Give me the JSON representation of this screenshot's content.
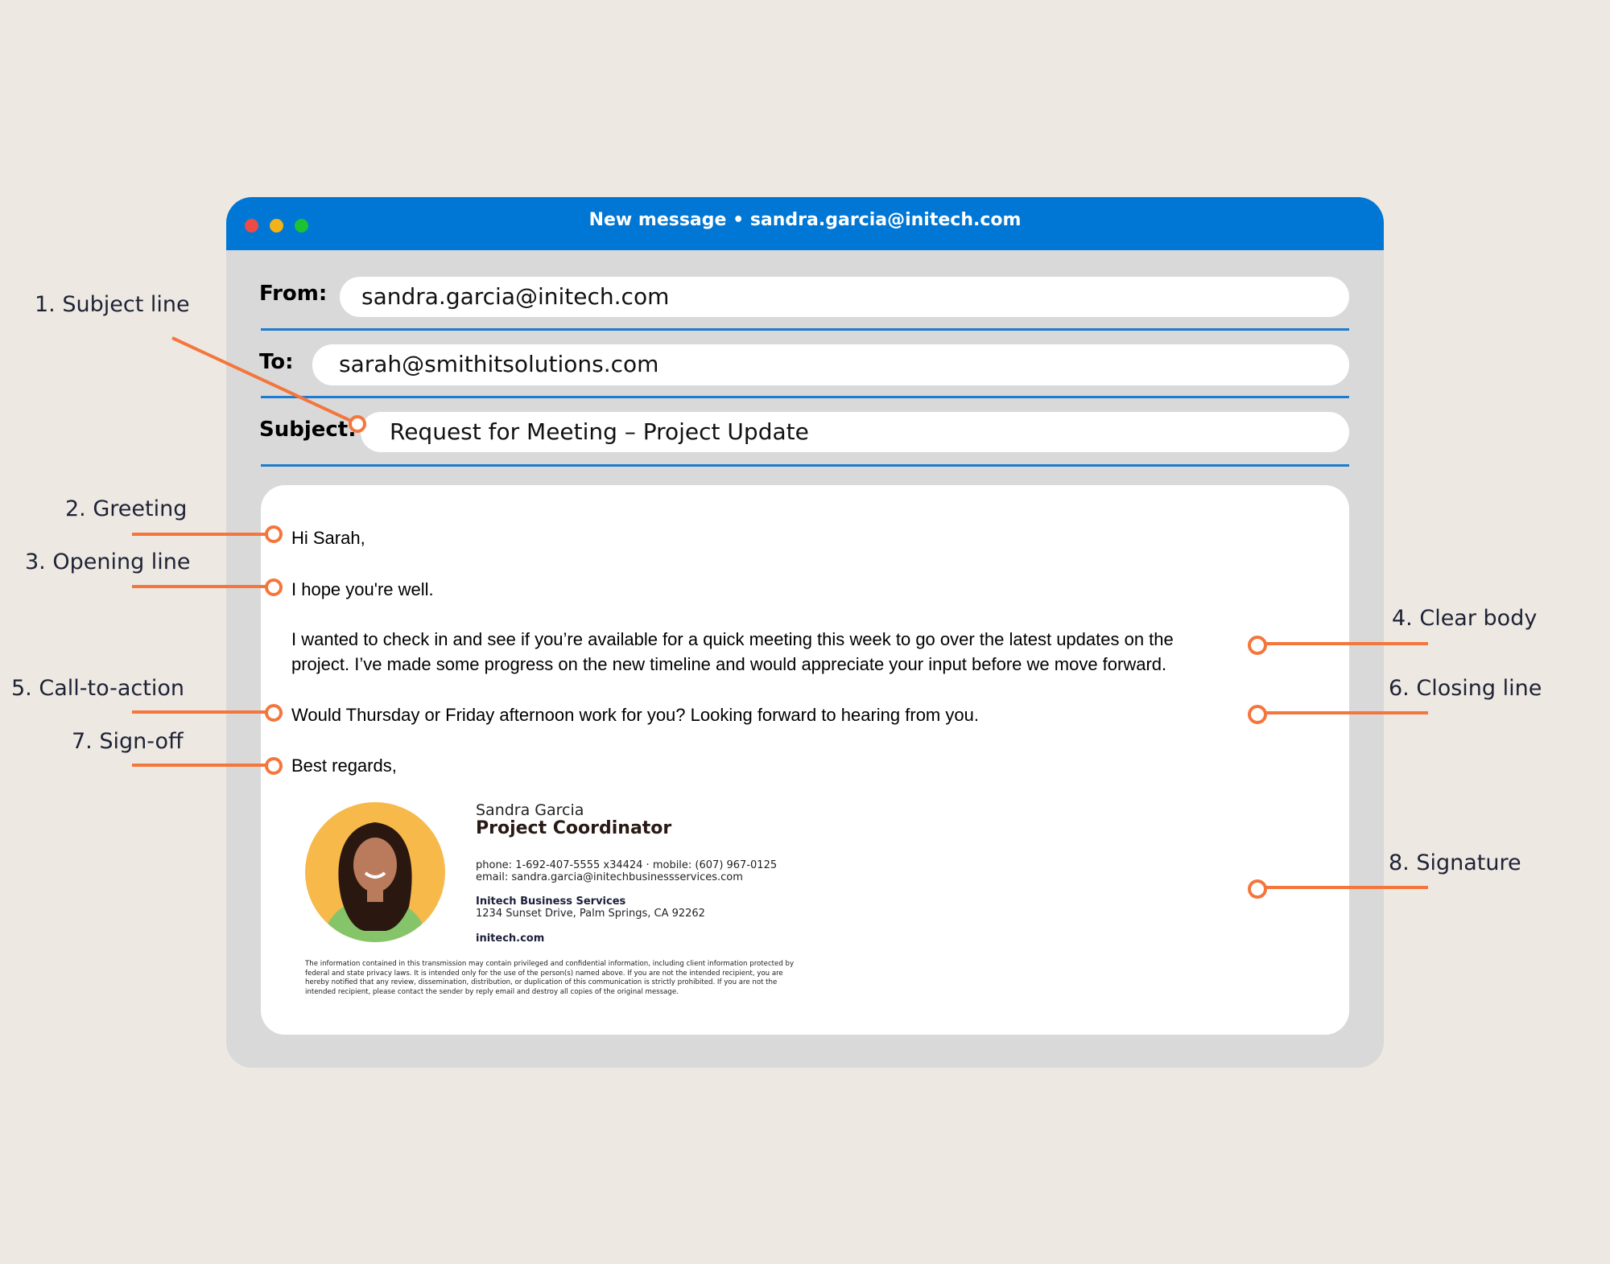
{
  "window": {
    "title": "New message • sandra.garcia@initech.com"
  },
  "fields": {
    "from_label": "From:",
    "from_value": "sandra.garcia@initech.com",
    "to_label": "To:",
    "to_value": "sarah@smithitsolutions.com",
    "subject_label": "Subject:",
    "subject_value": "Request for Meeting – Project Update"
  },
  "body": {
    "greeting": "Hi Sarah,",
    "opening": "I hope you're well.",
    "paragraph_line1": "I wanted to check in and see if you’re available for a quick meeting this week to go over the latest updates on the",
    "paragraph_line2": "project. I’ve made some progress on the new timeline and would appreciate your input before we move forward.",
    "cta": "Would Thursday or Friday afternoon work for you? Looking forward to hearing from you.",
    "signoff": "Best regards,"
  },
  "signature": {
    "name": "Sandra Garcia",
    "role": "Project Coordinator",
    "phone": "phone: 1-692-407-5555 x34424 · mobile: (607) 967-0125",
    "email": "email: sandra.garcia@initechbusinessservices.com",
    "company": "Initech Business Services",
    "address": "1234 Sunset Drive, Palm Springs, CA 92262",
    "website": "initech.com",
    "disclaimer": "The information contained in this transmission may contain privileged and confidential information, including client information protected by federal and state privacy laws. It is intended only for the use of the person(s) named above. If you are not the intended recipient, you are hereby notified that any review, dissemination, distribution, or duplication of this communication is strictly prohibited. If you are not the intended recipient, please contact the sender by reply email and destroy all copies of the original message."
  },
  "annotations": {
    "a1": "1. Subject line",
    "a2": "2. Greeting",
    "a3": "3. Opening line",
    "a4": "4. Clear body",
    "a5": "5. Call-to-action",
    "a6": "6. Closing line",
    "a7": "7. Sign-off",
    "a8": "8. Signature"
  },
  "colors": {
    "titlebar": "#0077d4",
    "annotation_accent": "#f4763c",
    "background": "#ede8e2",
    "window": "#d9d9d9"
  }
}
